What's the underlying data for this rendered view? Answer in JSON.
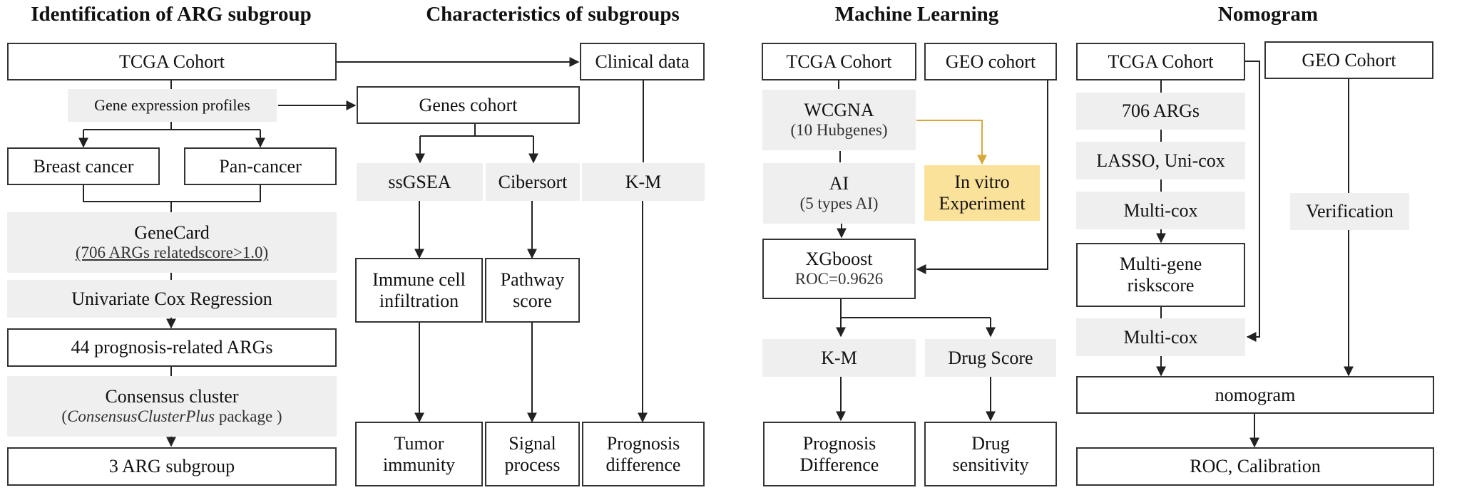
{
  "sections": {
    "identification": {
      "title": "Identification of ARG subgroup"
    },
    "characteristics": {
      "title": "Characteristics of subgroups"
    },
    "ml": {
      "title": "Machine Learning"
    },
    "nomogram": {
      "title": "Nomogram"
    }
  },
  "identification": {
    "tcga": "TCGA Cohort",
    "gene_expr": "Gene expression profiles",
    "breast": "Breast cancer",
    "pan": "Pan-cancer",
    "genecard": "GeneCard",
    "genecard_sub": "(706 ARGs relatedscore>1.0)",
    "univariate": "Univariate Cox Regression",
    "prognosis_args": "44 prognosis-related ARGs",
    "consensus": "Consensus cluster",
    "consensus_sub_open": "(",
    "consensus_sub_pkg": "ConsensusClusterPlus",
    "consensus_sub_close": " package )",
    "subgroup": "3 ARG subgroup"
  },
  "characteristics": {
    "clinical": "Clinical data",
    "genes_cohort": "Genes cohort",
    "ssgsea": "ssGSEA",
    "cibersort": "Cibersort",
    "km": "K-M",
    "immune_1": "Immune cell",
    "immune_2": "infiltration",
    "pathway_1": "Pathway",
    "pathway_2": "score",
    "tumor_1": "Tumor",
    "tumor_2": "immunity",
    "signal_1": "Signal",
    "signal_2": "process",
    "progdiff_1": "Prognosis",
    "progdiff_2": "difference"
  },
  "ml": {
    "tcga": "TCGA Cohort",
    "geo": "GEO cohort",
    "wcgna": "WCGNA",
    "wcgna_sub": "(10 Hubgenes)",
    "ai": "AI",
    "ai_sub": "(5 types AI)",
    "invitro_1": "In vitro",
    "invitro_2": "Experiment",
    "xgboost": "XGboost",
    "roc": "ROC=0.9626",
    "km": "K-M",
    "drug_score": "Drug Score",
    "progdiff_1": "Prognosis",
    "progdiff_2": "Difference",
    "drug_sens_1": "Drug",
    "drug_sens_2": "sensitivity"
  },
  "nomogram": {
    "tcga": "TCGA Cohort",
    "geo": "GEO Cohort",
    "args": "706 ARGs",
    "lasso": "LASSO, Uni-cox",
    "multicox1": "Multi-cox",
    "multigene_1": "Multi-gene",
    "multigene_2": "riskscore",
    "multicox2": "Multi-cox",
    "verification": "Verification",
    "nomogram": "nomogram",
    "roc_cal": "ROC, Calibration"
  },
  "colors": {
    "accent_arrow": "#d9a83a",
    "highlight_fill": "#fbe29a",
    "process_fill": "#efefef",
    "line": "#222222"
  }
}
